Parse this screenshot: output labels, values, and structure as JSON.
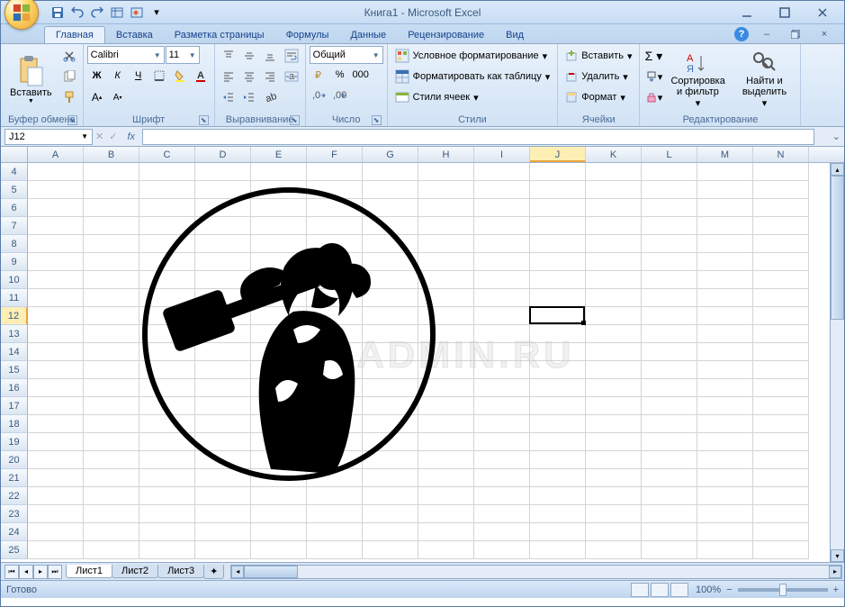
{
  "title": "Книга1 - Microsoft Excel",
  "tabs": [
    "Главная",
    "Вставка",
    "Разметка страницы",
    "Формулы",
    "Данные",
    "Рецензирование",
    "Вид"
  ],
  "activeTab": 0,
  "clipboard": {
    "paste": "Вставить",
    "label": "Буфер обмена"
  },
  "font": {
    "name": "Calibri",
    "size": "11",
    "label": "Шрифт",
    "bold": "Ж",
    "italic": "К",
    "underline": "Ч"
  },
  "align": {
    "label": "Выравнивание"
  },
  "number": {
    "format": "Общий",
    "label": "Число"
  },
  "styles": {
    "cond": "Условное форматирование",
    "table": "Форматировать как таблицу",
    "cell": "Стили ячеек",
    "label": "Стили"
  },
  "cells": {
    "insert": "Вставить",
    "delete": "Удалить",
    "format": "Формат",
    "label": "Ячейки"
  },
  "editing": {
    "sort": "Сортировка и фильтр",
    "find": "Найти и выделить",
    "label": "Редактирование"
  },
  "namebox": "J12",
  "columns": [
    "A",
    "B",
    "C",
    "D",
    "E",
    "F",
    "G",
    "H",
    "I",
    "J",
    "K",
    "L",
    "M",
    "N"
  ],
  "rowStart": 4,
  "rowEnd": 25,
  "selectedCell": {
    "col": "J",
    "row": 12
  },
  "sheets": [
    "Лист1",
    "Лист2",
    "Лист3"
  ],
  "activeSheet": 0,
  "status": "Готово",
  "zoom": "100%",
  "watermark": "SYSADMIN.RU"
}
